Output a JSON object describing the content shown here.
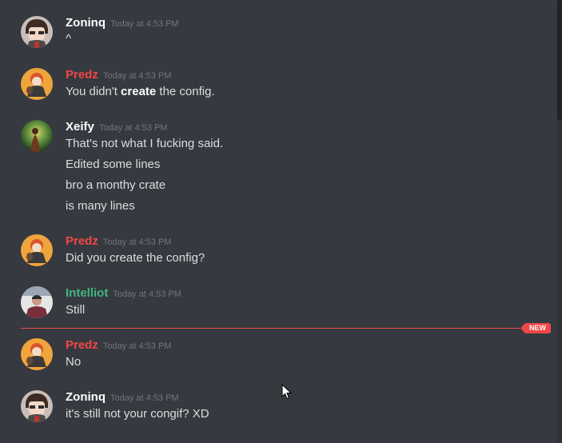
{
  "colors": {
    "zoninq": "#ffffff",
    "predz": "#f04747",
    "xeify": "#ffffff",
    "intelliot": "#43b581",
    "divider": "#f04747",
    "timestamp": "#72767d",
    "text": "#dcddde"
  },
  "messages": [
    {
      "author": "Zoninq",
      "timestamp": "Today at 4:53 PM",
      "avatar": "zoninq-avatar",
      "lines": [
        "^"
      ]
    },
    {
      "author": "Predz",
      "timestamp": "Today at 4:53 PM",
      "avatar": "predz-avatar",
      "lines": [
        {
          "before": "You didn't ",
          "bold": "create",
          "after": " the config."
        }
      ]
    },
    {
      "author": "Xeify",
      "timestamp": "Today at 4:53 PM",
      "avatar": "xeify-avatar",
      "lines": [
        "That's not what I fucking said.",
        "Edited some lines",
        "bro a  monthy crate",
        "is many lines"
      ]
    },
    {
      "author": "Predz",
      "timestamp": "Today at 4:53 PM",
      "avatar": "predz-avatar",
      "lines": [
        "Did you create the config?"
      ]
    },
    {
      "author": "Intelliot",
      "timestamp": "Today at 4:53 PM",
      "avatar": "intelliot-avatar",
      "lines": [
        "Still"
      ]
    },
    {
      "author": "Predz",
      "timestamp": "Today at 4:53 PM",
      "avatar": "predz-avatar",
      "lines": [
        "No"
      ]
    },
    {
      "author": "Zoninq",
      "timestamp": "Today at 4:53 PM",
      "avatar": "zoninq-avatar",
      "lines": [
        "it's still not your congif? XD"
      ]
    }
  ],
  "new_divider": {
    "label": "NEW"
  }
}
